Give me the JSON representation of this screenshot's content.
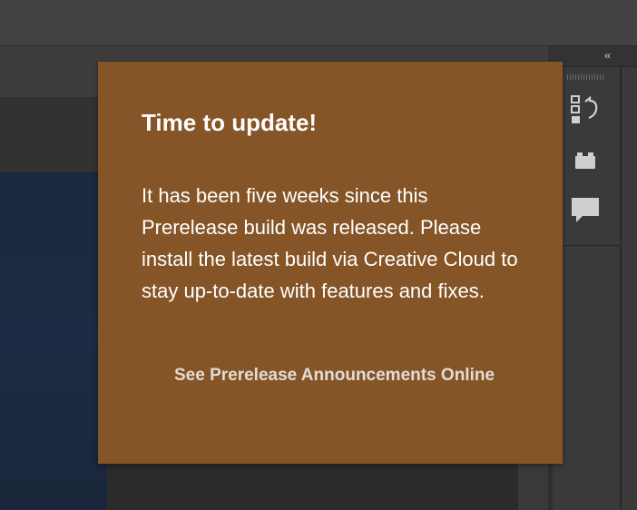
{
  "colors": {
    "popover_background": "#855527",
    "popover_text": "#ffffff",
    "link_text": "#e3dcd4",
    "ui_background": "#3a3a3a",
    "canvas_document": "#1b2a42"
  },
  "panel_dock": {
    "collapse_label": "‹‹",
    "icons": [
      "history-icon",
      "libraries-icon",
      "comments-icon"
    ]
  },
  "update_popover": {
    "title": "Time to update!",
    "message": "It has been five weeks since this Prerelease build was released. Please install the latest build via Creative Cloud to stay up-to-date with features and fixes.",
    "link_label": "See Prerelease Announcements Online"
  }
}
